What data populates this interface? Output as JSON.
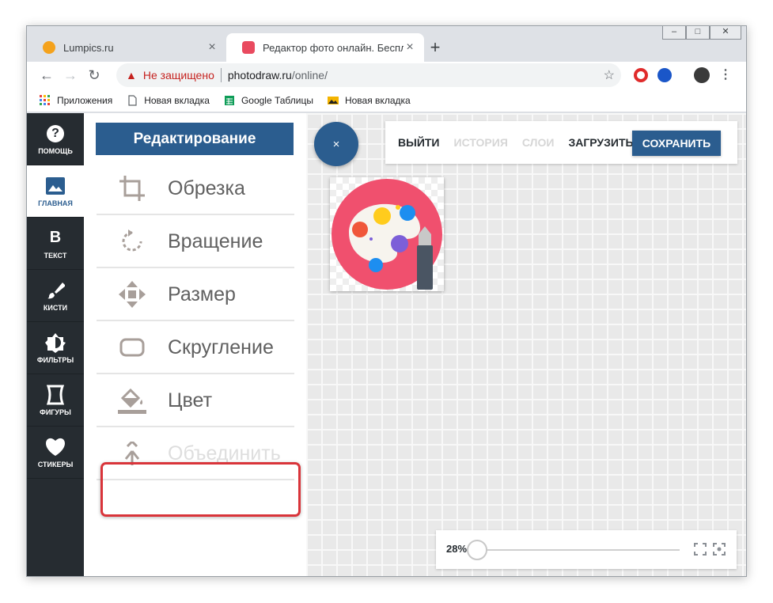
{
  "browser": {
    "tabs": [
      {
        "title": "Lumpics.ru",
        "close": "×"
      },
      {
        "title": "Редактор фото онлайн. Бесплат",
        "close": "×"
      }
    ],
    "new_tab": "+",
    "window_controls": {
      "minimize": "–",
      "maximize": "□",
      "close": "✕"
    },
    "nav": {
      "back": "←",
      "forward": "→",
      "reload": "↻"
    },
    "omnibox": {
      "security_icon": "▲",
      "security_text": "Не защищено",
      "host": "photodraw.ru",
      "path": "/online/"
    },
    "star": "☆",
    "menu": "⋮",
    "bookmarks": [
      {
        "label": "Приложения",
        "icon": "apps-icon"
      },
      {
        "label": "Новая вкладка",
        "icon": "page-icon"
      },
      {
        "label": "Google Таблицы",
        "icon": "sheets-icon"
      },
      {
        "label": "Новая вкладка",
        "icon": "image-icon"
      }
    ]
  },
  "sidebar": {
    "items": [
      {
        "label": "ПОМОЩЬ",
        "icon": "help-icon",
        "glyph": "?"
      },
      {
        "label": "ГЛАВНАЯ",
        "icon": "image-icon",
        "glyph": ""
      },
      {
        "label": "ТЕКСТ",
        "icon": "text-icon",
        "glyph": "B"
      },
      {
        "label": "КИСТИ",
        "icon": "brush-icon",
        "glyph": ""
      },
      {
        "label": "ФИЛЬТРЫ",
        "icon": "filters-icon",
        "glyph": ""
      },
      {
        "label": "ФИГУРЫ",
        "icon": "shapes-icon",
        "glyph": ""
      },
      {
        "label": "СТИКЕРЫ",
        "icon": "heart-icon",
        "glyph": ""
      }
    ],
    "active_index": 1
  },
  "panel": {
    "title": "Редактирование",
    "tools": [
      {
        "label": "Обрезка",
        "icon": "crop-icon",
        "disabled": false
      },
      {
        "label": "Вращение",
        "icon": "rotate-icon",
        "disabled": false
      },
      {
        "label": "Размер",
        "icon": "resize-icon",
        "disabled": false
      },
      {
        "label": "Скругление",
        "icon": "rounded-corners-icon",
        "disabled": false
      },
      {
        "label": "Цвет",
        "icon": "paint-bucket-icon",
        "disabled": false
      },
      {
        "label": "Объединить",
        "icon": "merge-icon",
        "disabled": true
      }
    ],
    "highlighted_tool": "Цвет"
  },
  "topbar": {
    "close_fab": "×",
    "items": [
      {
        "label": "ВЫЙТИ",
        "enabled": true
      },
      {
        "label": "ИСТОРИЯ",
        "enabled": false
      },
      {
        "label": "СЛОИ",
        "enabled": false
      },
      {
        "label": "ЗАГРУЗИТЬ",
        "enabled": true
      }
    ],
    "save_label": "СОХРАНИТЬ"
  },
  "zoom": {
    "value_label": "28%",
    "value": 28
  },
  "colors": {
    "accent": "#2b5d8f",
    "sidebar_bg": "#262c31",
    "highlight": "#d9343a"
  }
}
